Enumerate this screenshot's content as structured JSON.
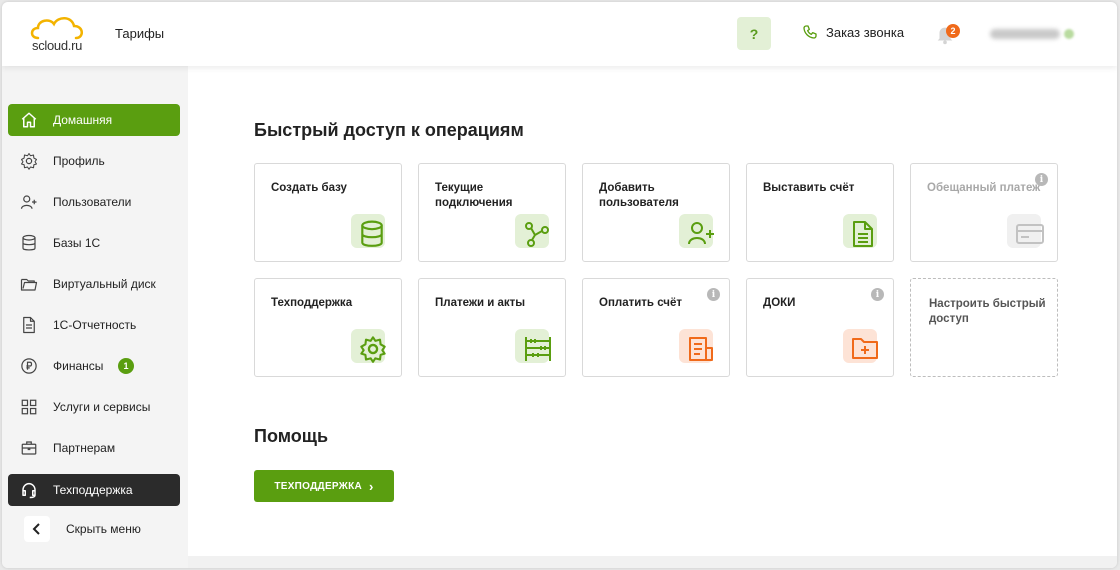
{
  "header": {
    "logo_text": "scloud.ru",
    "tariffs": "Тарифы",
    "help": "?",
    "callback": "Заказ звонка",
    "notifications_count": "2"
  },
  "sidebar": {
    "items": [
      {
        "label": "Домашняя",
        "icon": "home-icon"
      },
      {
        "label": "Профиль",
        "icon": "gear-icon"
      },
      {
        "label": "Пользователи",
        "icon": "user-plus-icon"
      },
      {
        "label": "Базы 1С",
        "icon": "database-icon"
      },
      {
        "label": "Виртуальный диск",
        "icon": "folder-icon"
      },
      {
        "label": "1С-Отчетность",
        "icon": "document-icon"
      },
      {
        "label": "Финансы",
        "icon": "ruble-icon",
        "badge": "1"
      },
      {
        "label": "Услуги и сервисы",
        "icon": "grid-icon"
      },
      {
        "label": "Партнерам",
        "icon": "briefcase-icon"
      },
      {
        "label": "Техподдержка",
        "icon": "headset-icon"
      }
    ],
    "collapse_label": "Скрыть меню"
  },
  "main": {
    "quick_title": "Быстрый доступ к операциям",
    "cards": [
      {
        "label": "Создать базу",
        "icon": "database-icon"
      },
      {
        "label": "Текущие подключения",
        "icon": "nodes-icon"
      },
      {
        "label": "Добавить пользователя",
        "icon": "user-plus-icon"
      },
      {
        "label": "Выставить счёт",
        "icon": "invoice-icon"
      },
      {
        "label": "Обещанный платеж",
        "icon": "card-icon"
      },
      {
        "label": "Техподдержка",
        "icon": "gear-icon"
      },
      {
        "label": "Платежи и акты",
        "icon": "abacus-icon"
      },
      {
        "label": "Оплатить счёт",
        "icon": "pay-invoice-icon"
      },
      {
        "label": "ДОКИ",
        "icon": "folder-plus-icon"
      },
      {
        "label": "Настроить быстрый доступ"
      }
    ],
    "info_glyph": "i",
    "help_title": "Помощь",
    "support_button": "ТЕХПОДДЕРЖКА",
    "support_chevron": "›"
  },
  "colors": {
    "accent": "#5a9e10",
    "accent_light": "#e3f0d6",
    "orange": "#f06a1a",
    "orange_light": "#fde3d6",
    "dark_item": "#2b2b2b"
  }
}
